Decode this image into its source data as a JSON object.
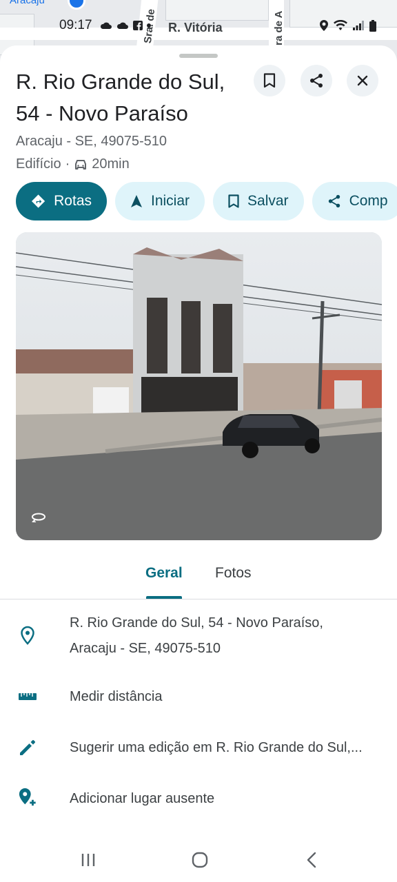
{
  "map": {
    "city_label": "Aracaju",
    "street_labels": [
      "R. Vitória",
      "Sra. de",
      "ira de A"
    ]
  },
  "status_bar": {
    "time": "09:17",
    "left_icons": [
      "cloud-icon",
      "cloud-icon",
      "facebook-icon",
      "dot-icon"
    ],
    "right_icons": [
      "location-icon",
      "wifi-icon",
      "signal-icon",
      "battery-icon"
    ]
  },
  "place": {
    "title_line1": "R. Rio Grande do Sul,",
    "title_line2": "54 - Novo Paraíso",
    "address": "Aracaju - SE, 49075-510",
    "type": "Edifício",
    "separator": "·",
    "travel_time": "20min"
  },
  "actions": [
    {
      "label": "Rotas",
      "icon": "directions-icon"
    },
    {
      "label": "Iniciar",
      "icon": "navigation-arrow-icon"
    },
    {
      "label": "Salvar",
      "icon": "bookmark-icon"
    },
    {
      "label": "Comp",
      "icon": "share-icon"
    }
  ],
  "tabs": {
    "geral": "Geral",
    "fotos": "Fotos",
    "active": "Geral"
  },
  "info_rows": {
    "address_line1": "R. Rio Grande do Sul, 54 - Novo Paraíso,",
    "address_line2": "Aracaju - SE, 49075-510",
    "measure": "Medir distância",
    "suggest_edit": "Sugerir uma edição em R. Rio Grande do Sul,...",
    "add_place": "Adicionar lugar ausente"
  },
  "colors": {
    "accent": "#0b6e82",
    "chip_secondary": "#dff4fa"
  }
}
